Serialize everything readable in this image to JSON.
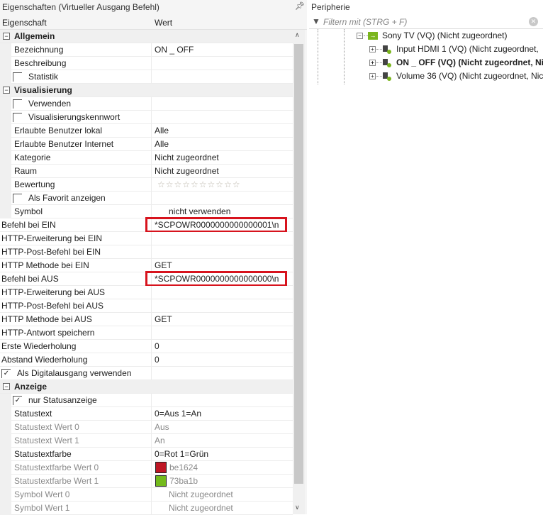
{
  "left_panel": {
    "title": "Eigenschaften (Virtueller Ausgang Befehl)",
    "pin_icon": "pin-icon",
    "col_property": "Eigenschaft",
    "col_value": "Wert"
  },
  "rows": [
    {
      "type": "group",
      "label": "Allgemein"
    },
    {
      "type": "prop",
      "indent": 1,
      "label": "Bezeichnung",
      "value": "ON _ OFF"
    },
    {
      "type": "prop",
      "indent": 1,
      "label": "Beschreibung",
      "value": ""
    },
    {
      "type": "check",
      "indent": 1,
      "label": "Statistik",
      "checked": false
    },
    {
      "type": "group",
      "label": "Visualisierung"
    },
    {
      "type": "check",
      "indent": 1,
      "label": "Verwenden",
      "checked": false
    },
    {
      "type": "check",
      "indent": 1,
      "label": "Visualisierungskennwort",
      "checked": false
    },
    {
      "type": "prop",
      "indent": 1,
      "label": "Erlaubte Benutzer lokal",
      "value": "Alle"
    },
    {
      "type": "prop",
      "indent": 1,
      "label": "Erlaubte Benutzer Internet",
      "value": "Alle"
    },
    {
      "type": "prop",
      "indent": 1,
      "label": "Kategorie",
      "value": "Nicht zugeordnet"
    },
    {
      "type": "prop",
      "indent": 1,
      "label": "Raum",
      "value": "Nicht zugeordnet"
    },
    {
      "type": "stars",
      "indent": 1,
      "label": "Bewertung",
      "stars_total": 10,
      "stars_filled": 0
    },
    {
      "type": "check",
      "indent": 1,
      "label": "Als Favorit anzeigen",
      "checked": false
    },
    {
      "type": "prop",
      "indent": 1,
      "label": "Symbol",
      "value": "nicht verwenden",
      "value_offset": true
    },
    {
      "type": "prop",
      "indent": 0,
      "label": "Befehl bei EIN",
      "value": "*SCPOWR0000000000000001\\n",
      "highlight": true
    },
    {
      "type": "prop",
      "indent": 0,
      "label": "HTTP-Erweiterung bei EIN",
      "value": ""
    },
    {
      "type": "prop",
      "indent": 0,
      "label": "HTTP-Post-Befehl bei EIN",
      "value": ""
    },
    {
      "type": "prop",
      "indent": 0,
      "label": "HTTP Methode bei EIN",
      "value": "GET"
    },
    {
      "type": "prop",
      "indent": 0,
      "label": "Befehl bei AUS",
      "value": "*SCPOWR0000000000000000\\n",
      "highlight": true
    },
    {
      "type": "prop",
      "indent": 0,
      "label": "HTTP-Erweiterung bei AUS",
      "value": ""
    },
    {
      "type": "prop",
      "indent": 0,
      "label": "HTTP-Post-Befehl bei AUS",
      "value": ""
    },
    {
      "type": "prop",
      "indent": 0,
      "label": "HTTP Methode bei AUS",
      "value": "GET"
    },
    {
      "type": "prop",
      "indent": 0,
      "label": "HTTP-Antwort speichern",
      "value": ""
    },
    {
      "type": "prop",
      "indent": 0,
      "label": "Erste Wiederholung",
      "value": "0"
    },
    {
      "type": "prop",
      "indent": 0,
      "label": "Abstand Wiederholung",
      "value": "0"
    },
    {
      "type": "check",
      "indent": 0,
      "label": "Als Digitalausgang verwenden",
      "checked": true
    },
    {
      "type": "group",
      "label": "Anzeige"
    },
    {
      "type": "check",
      "indent": 1,
      "label": "nur Statusanzeige",
      "checked": true
    },
    {
      "type": "prop",
      "indent": 1,
      "label": "Statustext",
      "value": "0=Aus 1=An"
    },
    {
      "type": "prop",
      "indent": 1,
      "label": "Statustext Wert 0",
      "value": "Aus",
      "muted": true
    },
    {
      "type": "prop",
      "indent": 1,
      "label": "Statustext Wert 1",
      "value": "An",
      "muted": true
    },
    {
      "type": "prop",
      "indent": 1,
      "label": "Statustextfarbe",
      "value": "0=Rot 1=Grün"
    },
    {
      "type": "prop",
      "indent": 1,
      "label": "Statustextfarbe Wert 0",
      "value": "be1624",
      "swatch": "#be1624",
      "muted": true
    },
    {
      "type": "prop",
      "indent": 1,
      "label": "Statustextfarbe Wert 1",
      "value": "73ba1b",
      "swatch": "#73ba1b",
      "muted": true
    },
    {
      "type": "prop",
      "indent": 1,
      "label": "Symbol Wert 0",
      "value": "Nicht zugeordnet",
      "value_offset": true,
      "muted": true
    },
    {
      "type": "prop",
      "indent": 1,
      "label": "Symbol Wert 1",
      "value": "Nicht zugeordnet",
      "value_offset": true,
      "muted": true
    }
  ],
  "right_panel": {
    "title": "Peripherie",
    "filter_placeholder": "Filtern mit (STRG + F)",
    "tree": [
      {
        "label": "Sony TV (VQ) (Nicht zugeordnet)",
        "icon": "green-arrow-icon",
        "level": 0,
        "expanded": true
      },
      {
        "label": "Input HDMI 1 (VQ) (Nicht zugeordnet,",
        "icon": "device-icon",
        "level": 1
      },
      {
        "label": "ON _ OFF (VQ) (Nicht zugeordnet, Nic",
        "icon": "device-icon",
        "level": 1,
        "selected": true
      },
      {
        "label": "Volume 36 (VQ) (Nicht zugeordnet, Nic",
        "icon": "device-icon",
        "level": 1
      }
    ]
  },
  "colors": {
    "highlight": "#d7131d",
    "accent_green": "#7ab51d"
  }
}
